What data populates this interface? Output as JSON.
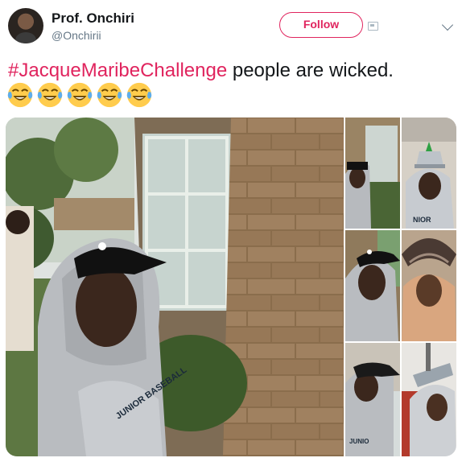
{
  "tweet": {
    "author": {
      "display_name": "Prof. Onchiri",
      "handle": "@Onchirii"
    },
    "follow_label": "Follow",
    "text": {
      "hashtag": "#JacqueMaribeChallenge",
      "rest": " people are wicked."
    },
    "emojis": [
      "face-with-tears-of-joy-icon",
      "face-with-tears-of-joy-icon",
      "face-with-tears-of-joy-icon",
      "face-with-tears-of-joy-icon",
      "face-with-tears-of-joy-icon"
    ],
    "media": {
      "main": "photo-person-in-grey-hoodie-by-stone-wall",
      "thumbnails": [
        "photo-hoodie-person-at-wall",
        "photo-person-with-pot-on-head",
        "photo-hoodie-person-close-up",
        "photo-person-under-umbrella-hat",
        "photo-hoodie-person-side",
        "photo-person-with-helmet-hat"
      ],
      "hoodie_print": "JUNIOR BASEBALL"
    }
  },
  "colors": {
    "accent": "#e0245e",
    "text": "#14171a",
    "secondary": "#657786"
  }
}
